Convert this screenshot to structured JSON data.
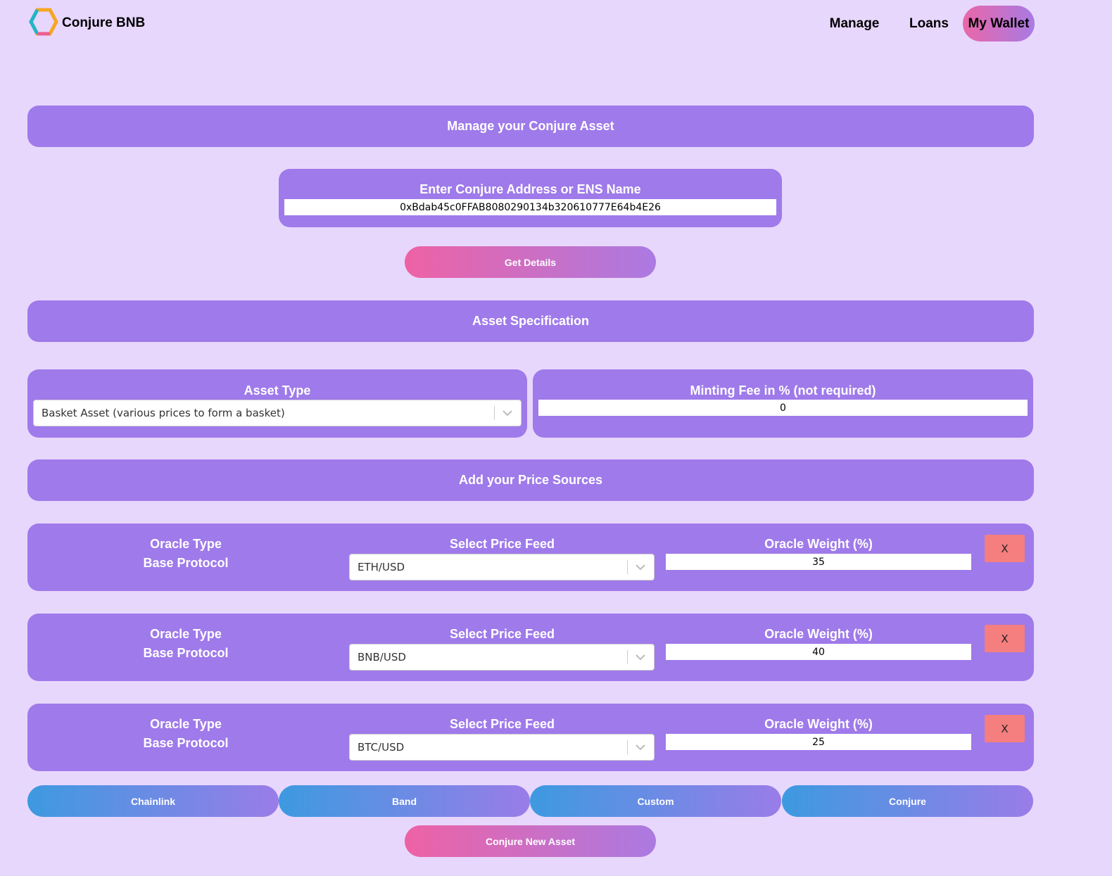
{
  "nav": {
    "brand": "Conjure BNB",
    "links": [
      "Manage",
      "Loans"
    ],
    "wallet": "My Wallet"
  },
  "manage": {
    "title": "Manage your Conjure Asset",
    "address_label": "Enter Conjure Address or ENS Name",
    "address_value": "0xBdab45c0FFAB8080290134b320610777E64b4E26",
    "get_details": "Get Details"
  },
  "spec": {
    "title": "Asset Specification",
    "asset_type_label": "Asset Type",
    "asset_type_value": "Basket Asset (various prices to form a basket)",
    "fee_label": "Minting Fee in % (not required)",
    "fee_value": "0"
  },
  "sources": {
    "title": "Add your Price Sources",
    "rows": [
      {
        "oracle_type_label": "Oracle Type",
        "oracle_type_value": "Base Protocol",
        "feed_label": "Select Price Feed",
        "feed_value": "ETH/USD",
        "weight_label": "Oracle Weight (%)",
        "weight_value": "35",
        "remove": "X"
      },
      {
        "oracle_type_label": "Oracle Type",
        "oracle_type_value": "Base Protocol",
        "feed_label": "Select Price Feed",
        "feed_value": "BNB/USD",
        "weight_label": "Oracle Weight (%)",
        "weight_value": "40",
        "remove": "X"
      },
      {
        "oracle_type_label": "Oracle Type",
        "oracle_type_value": "Base Protocol",
        "feed_label": "Select Price Feed",
        "feed_value": "BTC/USD",
        "weight_label": "Oracle Weight (%)",
        "weight_value": "25",
        "remove": "X"
      }
    ]
  },
  "add_buttons": [
    "Chainlink",
    "Band",
    "Custom",
    "Conjure"
  ],
  "submit": "Conjure New Asset",
  "colors": {
    "page_bg": "#e8d7fd",
    "panel": "#9f7aea",
    "pink_accent": "#ee62a5",
    "blue_accent": "#3d9ae0",
    "remove_button": "#f57e7e"
  }
}
